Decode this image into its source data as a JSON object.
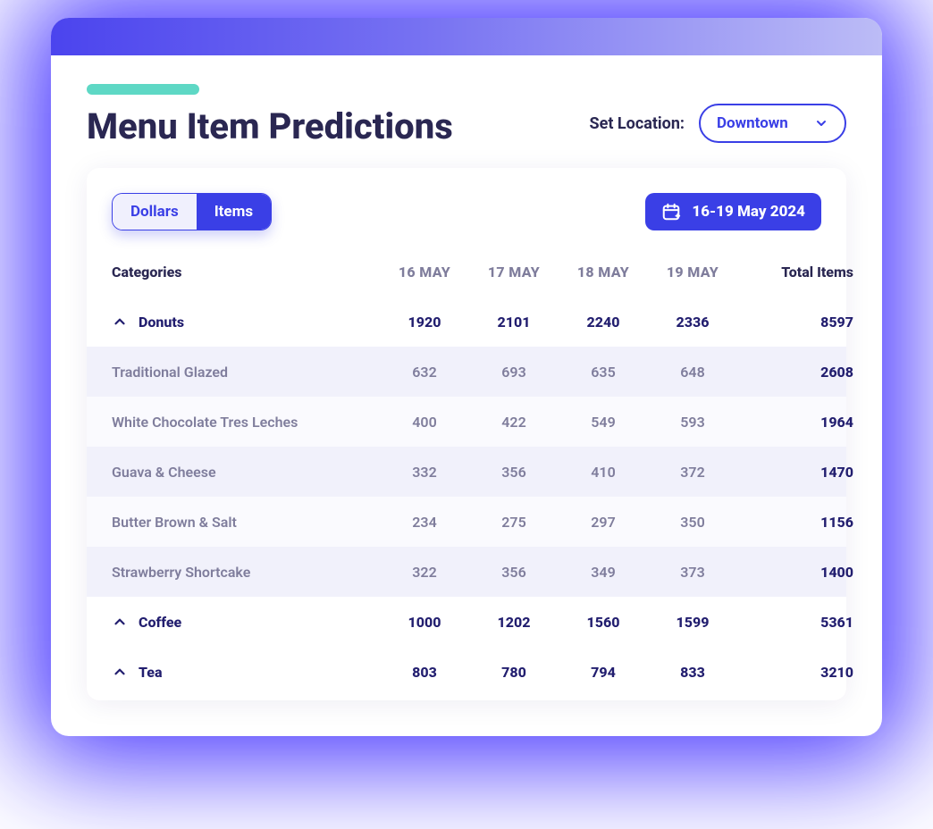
{
  "header": {
    "title": "Menu Item Predictions",
    "location_label": "Set Location:",
    "location_value": "Downtown"
  },
  "toolbar": {
    "tab_dollars": "Dollars",
    "tab_items": "Items",
    "date_range": "16-19 May 2024"
  },
  "table": {
    "col_categories": "Categories",
    "dates": [
      "16 MAY",
      "17 MAY",
      "18 MAY",
      "19 MAY"
    ],
    "col_total": "Total Items",
    "groups": [
      {
        "name": "Donuts",
        "days": [
          "1920",
          "2101",
          "2240",
          "2336"
        ],
        "total": "8597",
        "items": [
          {
            "name": "Traditional Glazed",
            "days": [
              "632",
              "693",
              "635",
              "648"
            ],
            "total": "2608"
          },
          {
            "name": "White Chocolate Tres Leches",
            "days": [
              "400",
              "422",
              "549",
              "593"
            ],
            "total": "1964"
          },
          {
            "name": "Guava & Cheese",
            "days": [
              "332",
              "356",
              "410",
              "372"
            ],
            "total": "1470"
          },
          {
            "name": "Butter Brown & Salt",
            "days": [
              "234",
              "275",
              "297",
              "350"
            ],
            "total": "1156"
          },
          {
            "name": "Strawberry Shortcake",
            "days": [
              "322",
              "356",
              "349",
              "373"
            ],
            "total": "1400"
          }
        ]
      },
      {
        "name": "Coffee",
        "days": [
          "1000",
          "1202",
          "1560",
          "1599"
        ],
        "total": "5361",
        "items": []
      },
      {
        "name": "Tea",
        "days": [
          "803",
          "780",
          "794",
          "833"
        ],
        "total": "3210",
        "items": []
      }
    ]
  }
}
